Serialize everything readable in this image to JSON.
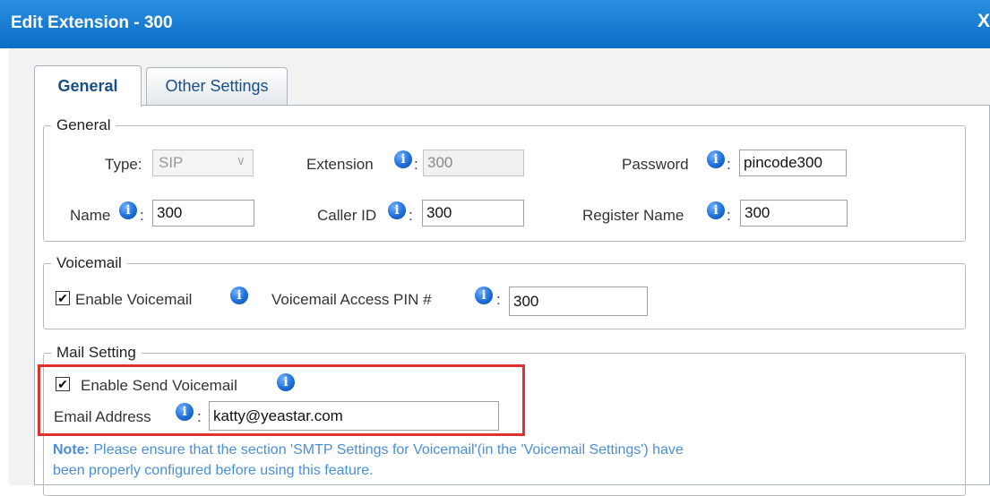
{
  "window": {
    "title": "Edit Extension - 300",
    "close_label": "X"
  },
  "tabs": [
    {
      "label": "General",
      "active": true
    },
    {
      "label": "Other Settings",
      "active": false
    }
  ],
  "general": {
    "legend": "General",
    "type_label": "Type:",
    "type_value": "SIP",
    "extension_label": "Extension",
    "extension_value": "300",
    "password_label": "Password",
    "password_value": "pincode300",
    "name_label": "Name",
    "name_value": "300",
    "callerid_label": "Caller ID",
    "callerid_value": "300",
    "register_label": "Register Name",
    "register_value": "300"
  },
  "voicemail": {
    "legend": "Voicemail",
    "enable_label": "Enable Voicemail",
    "enable_checked": true,
    "pin_label": "Voicemail Access PIN #",
    "pin_value": "300"
  },
  "mail": {
    "legend": "Mail Setting",
    "send_label": "Enable Send Voicemail",
    "send_checked": true,
    "email_label": "Email Address",
    "email_value": "katty@yeastar.com",
    "note_prefix": "Note:",
    "note_line1": " Please ensure that the section 'SMTP Settings for Voicemail'(in the 'Voicemail Settings') have",
    "note_line2": "been properly configured before using this feature."
  },
  "common": {
    "colon": ":",
    "info_glyph": "i",
    "check_glyph": "✔",
    "chevron_glyph": "∨"
  },
  "colors": {
    "titlebar": "#0b6dc6",
    "highlight": "#e0302f",
    "note": "#4a8fd6"
  }
}
